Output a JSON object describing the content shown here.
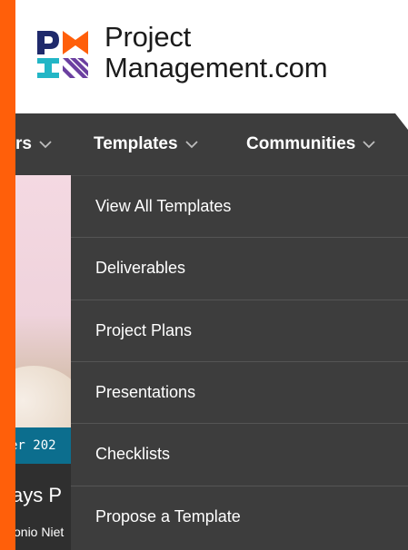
{
  "header": {
    "logo_line1": "Project",
    "logo_line2": "Management.com",
    "logo_trademark": "."
  },
  "nav": {
    "prev_partial_label": "rs",
    "templates_label": "Templates",
    "communities_label": "Communities"
  },
  "dropdown": {
    "items": [
      {
        "label": "View All Templates"
      },
      {
        "label": "Deliverables"
      },
      {
        "label": "Project Plans"
      },
      {
        "label": "Presentations"
      },
      {
        "label": "Checklists"
      },
      {
        "label": "Propose a Template"
      }
    ]
  },
  "background_article": {
    "date_partial": "er 202",
    "title_partial": "ays P",
    "author_partial": "onio Niet"
  },
  "colors": {
    "accent_orange": "#ff5f0a",
    "nav_bg": "#3d3d3d",
    "ribbon_teal": "#0c6e8e",
    "logo_orange": "#ff5f0a",
    "logo_navy": "#1f2a6b",
    "logo_teal": "#23b6c6",
    "logo_purple": "#6b3fa0"
  },
  "icons": [
    "pmi-logo-icon",
    "chevron-down-icon"
  ]
}
